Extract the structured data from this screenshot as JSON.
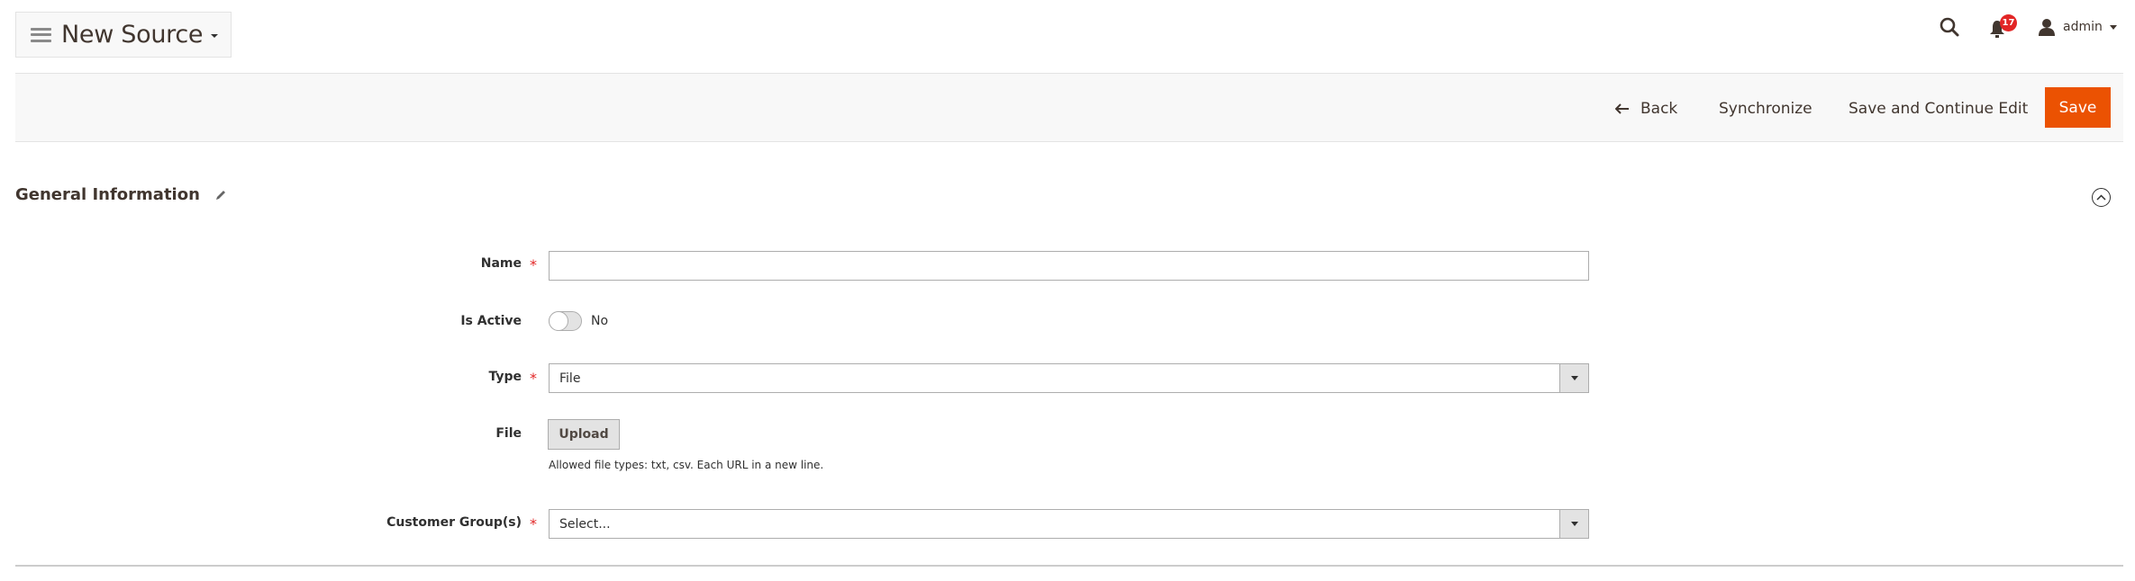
{
  "header": {
    "title": "New Source",
    "notifications_count": "17",
    "user_name": "admin",
    "icons": {
      "menu": "hamburger-icon",
      "search": "search-icon",
      "notifications": "bell-icon",
      "user": "user-icon"
    }
  },
  "action_bar": {
    "back_label": "Back",
    "synchronize_label": "Synchronize",
    "save_continue_label": "Save and Continue Edit",
    "save_label": "Save"
  },
  "section": {
    "title": "General Information",
    "edit_icon": "pencil-icon",
    "collapse_icon": "chevron-up-circle-icon"
  },
  "form": {
    "name": {
      "label": "Name",
      "required": true,
      "value": "",
      "placeholder": ""
    },
    "is_active": {
      "label": "Is Active",
      "value_label": "No",
      "checked": false
    },
    "type": {
      "label": "Type",
      "required": true,
      "value": "File"
    },
    "file": {
      "label": "File",
      "button_label": "Upload",
      "note": "Allowed file types: txt, csv. Each URL in a new line."
    },
    "customer_groups": {
      "label": "Customer Group(s)",
      "required": true,
      "value": "Select..."
    }
  },
  "colors": {
    "primary_action": "#eb5202",
    "badge": "#e22626",
    "required": "#e22626"
  }
}
